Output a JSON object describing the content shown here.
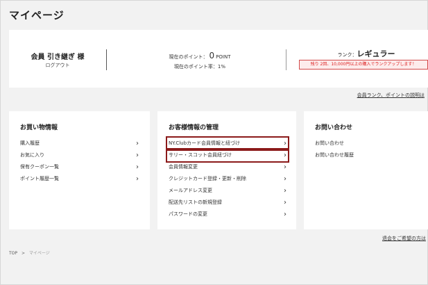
{
  "page_title": "マイページ",
  "member": {
    "name": "会員 引き継ぎ 様",
    "logout_label": "ログアウト",
    "points_prefix": "現在のポイント：",
    "points_value": "0",
    "points_unit": "POINT",
    "rate_text": "現在のポイント率：1%",
    "rank_label": "ランク：",
    "rank_value": "レギュラー",
    "rank_notice": "残り 2回、10,000円以上の購入でランクアップします！"
  },
  "rank_info_link": "会員ランク、ポイントの説明は",
  "cards": {
    "shopping": {
      "title": "お買い物情報",
      "items": [
        "購入履歴",
        "お気に入り",
        "保有クーポン一覧",
        "ポイント履歴一覧"
      ]
    },
    "account": {
      "title": "お客様情報の管理",
      "items": [
        "NY.Clubカード会員情報と紐づけ",
        "サリー・スコット会員紐づけ",
        "会員情報変更",
        "クレジットカード登録・更新・削除",
        "メールアドレス変更",
        "配送先リストの新規登録",
        "パスワードの変更"
      ]
    },
    "contact": {
      "title": "お問い合わせ",
      "items": [
        "お問い合わせ",
        "お問い合わせ履歴"
      ]
    }
  },
  "bottom_link": "退会をご希望の方は",
  "breadcrumb": {
    "home": "TOP",
    "separator": ">",
    "current": "マイページ"
  },
  "icons": {
    "chevron": "chevron-right-icon"
  },
  "colors": {
    "highlight_border": "#8b1a1a",
    "notice_red": "#d22222"
  }
}
